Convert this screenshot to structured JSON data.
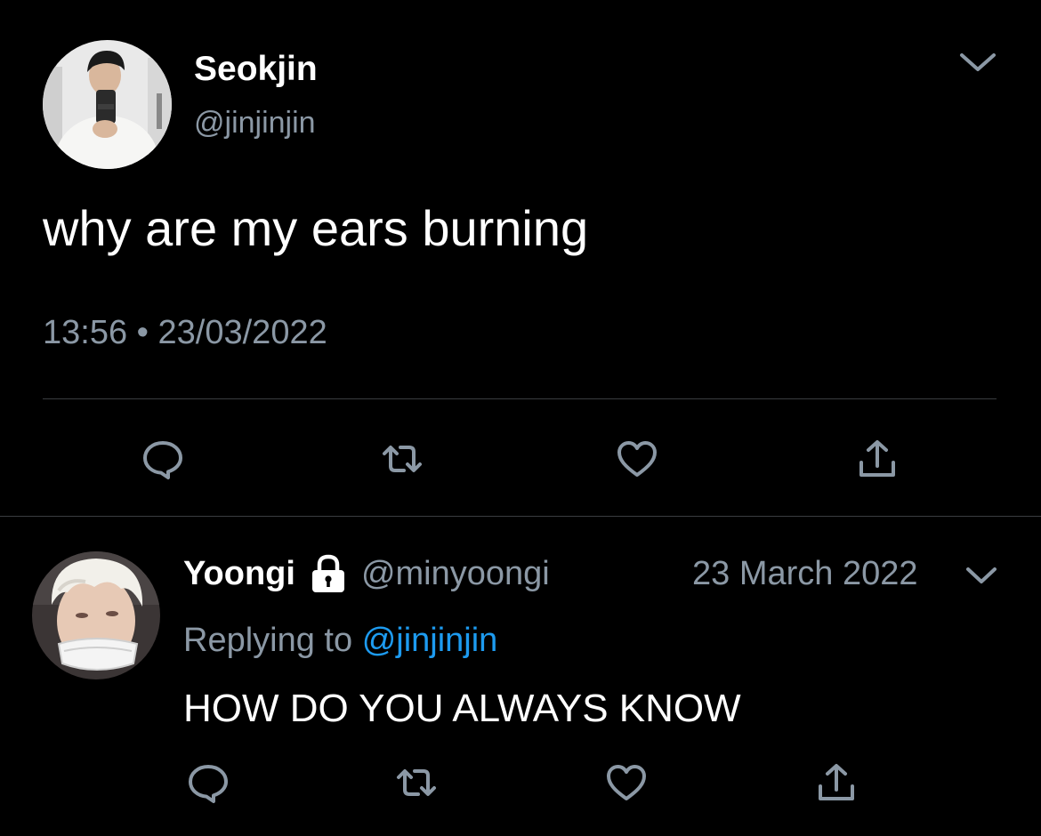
{
  "tweet": {
    "display_name": "Seokjin",
    "handle": "@jinjinjin",
    "text": "why are my ears burning",
    "time": "13:56",
    "separator": "•",
    "date": "23/03/2022",
    "avatar_icon": "person-taking-mirror-selfie",
    "menu_icon": "chevron-down-icon",
    "actions": [
      "reply-icon",
      "retweet-icon",
      "like-icon",
      "share-icon"
    ]
  },
  "reply": {
    "display_name": "Yoongi",
    "protected_icon": "lock-icon",
    "handle": "@minyoongi",
    "date": "23 March 2022",
    "replying_prefix": "Replying to",
    "replying_mention": "@jinjinjin",
    "text": "HOW DO YOU ALWAYS KNOW",
    "avatar_icon": "person-with-white-hair-and-mask",
    "menu_icon": "chevron-down-icon",
    "actions": [
      "reply-icon",
      "retweet-icon",
      "like-icon",
      "share-icon"
    ]
  },
  "colors": {
    "background": "#000000",
    "primary_text": "#ffffff",
    "secondary_text": "#8b98a5",
    "link": "#1d9bf0",
    "divider": "#3a3d40"
  }
}
